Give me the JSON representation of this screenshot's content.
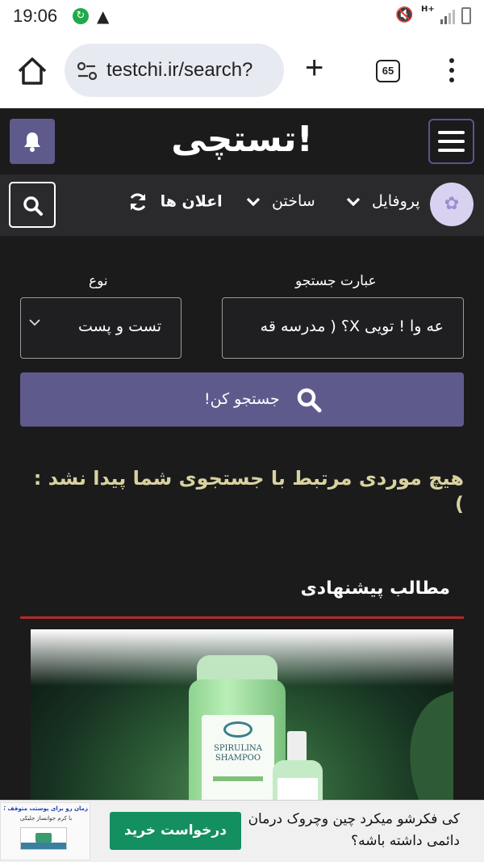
{
  "status_bar": {
    "time": "19:06",
    "network_label": "H+"
  },
  "browser": {
    "url": "testchi.ir/search?",
    "tab_count": "65",
    "new_tab_symbol": "+"
  },
  "site": {
    "logo_text": "تستچی!",
    "accent_color": "#5e5b8c"
  },
  "nav": {
    "profile_label": "پروفایل",
    "create_label": "ساختن",
    "notifications_label": "اعلان ها"
  },
  "search_form": {
    "query_label": "عبارت جستجو",
    "query_value": "عه وا ! تویی X؟ ( مدرسه قه",
    "type_label": "نوع",
    "type_value": "تست و پست",
    "submit_label": "جستجو کن!"
  },
  "results": {
    "empty_message": "هیچ موردی مرتبط با جستجوی شما پیدا نشد : )"
  },
  "suggested": {
    "title": "مطالب پیشنهادی",
    "product_label": "SPIRULINA SHAMPOO"
  },
  "ad": {
    "headline": "کی فکرشو میکرد چین وچروک درمان دائمی داشته باشه؟",
    "cta_label": "درخواست خرید",
    "thumb_line1": "زمان رو برای پوستت متوقف کن!",
    "thumb_line2": "با کرم جوانساز جلیکی"
  }
}
